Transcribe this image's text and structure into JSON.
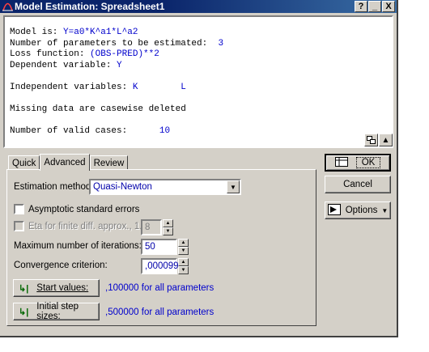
{
  "window": {
    "title": "Model Estimation: Spreadsheet1",
    "title_buttons": [
      "?",
      "_",
      "X"
    ]
  },
  "output": {
    "model_label": "Model is: ",
    "model_value": "Y=a0*K^a1*L^a2",
    "params_label": "Number of parameters to be estimated:",
    "params_value": "3",
    "loss_label": "Loss function: ",
    "loss_value": "(OBS-PRED)**2",
    "dep_label": "Dependent variable: ",
    "dep_value": "Y",
    "indep_label": "Independent variables: ",
    "indep_value_1": "K",
    "indep_value_2": "L",
    "missing_text": "Missing data are casewise deleted",
    "valid_label": "Number of valid cases:",
    "valid_value": "10"
  },
  "tabs": [
    {
      "label": "Quick",
      "active": false
    },
    {
      "label": "Advanced",
      "active": true
    },
    {
      "label": "Review",
      "active": false
    }
  ],
  "advanced": {
    "estimation_method_label": "Estimation method:",
    "estimation_method_value": "Quasi-Newton",
    "asymptotic_label": "Asymptotic standard errors",
    "asymptotic_checked": false,
    "eta_label": "Eta for finite diff. approx., 1.E-",
    "eta_value": "8",
    "eta_enabled": false,
    "max_iter_label": "Maximum number of iterations:",
    "max_iter_value": "50",
    "convergence_label": "Convergence criterion:",
    "convergence_value": ",000099",
    "start_values_label": "Start values:",
    "start_values_text": ",100000 for all parameters",
    "step_sizes_label": "Initial step sizes:",
    "step_sizes_text": ",500000 for all parameters"
  },
  "buttons": {
    "ok": "OK",
    "cancel": "Cancel",
    "options": "Options"
  },
  "colors": {
    "title_bar": "#0a246a",
    "dialog_face": "#d4d0c8",
    "value_text": "#0000cc"
  }
}
